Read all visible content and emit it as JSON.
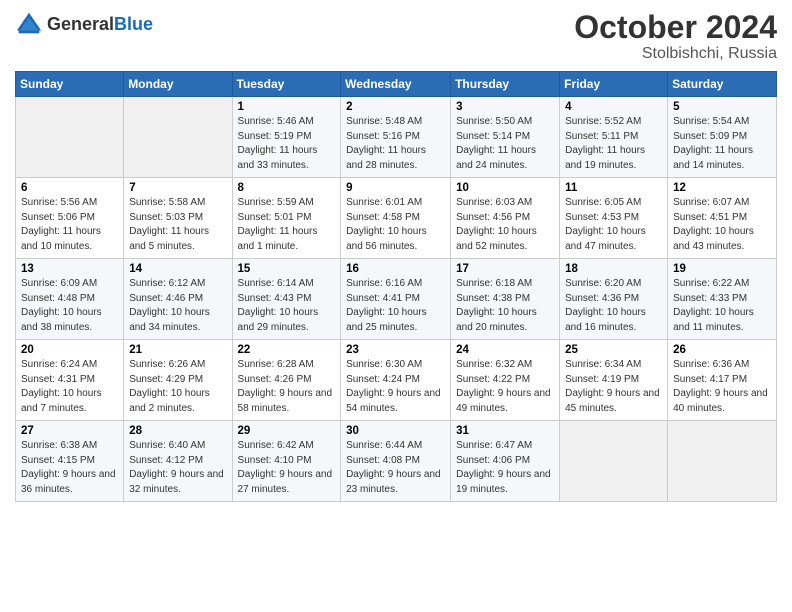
{
  "header": {
    "logo_general": "General",
    "logo_blue": "Blue",
    "month": "October 2024",
    "location": "Stolbishchi, Russia"
  },
  "days_of_week": [
    "Sunday",
    "Monday",
    "Tuesday",
    "Wednesday",
    "Thursday",
    "Friday",
    "Saturday"
  ],
  "weeks": [
    [
      {
        "day": "",
        "info": ""
      },
      {
        "day": "",
        "info": ""
      },
      {
        "day": "1",
        "info": "Sunrise: 5:46 AM\nSunset: 5:19 PM\nDaylight: 11 hours and 33 minutes."
      },
      {
        "day": "2",
        "info": "Sunrise: 5:48 AM\nSunset: 5:16 PM\nDaylight: 11 hours and 28 minutes."
      },
      {
        "day": "3",
        "info": "Sunrise: 5:50 AM\nSunset: 5:14 PM\nDaylight: 11 hours and 24 minutes."
      },
      {
        "day": "4",
        "info": "Sunrise: 5:52 AM\nSunset: 5:11 PM\nDaylight: 11 hours and 19 minutes."
      },
      {
        "day": "5",
        "info": "Sunrise: 5:54 AM\nSunset: 5:09 PM\nDaylight: 11 hours and 14 minutes."
      }
    ],
    [
      {
        "day": "6",
        "info": "Sunrise: 5:56 AM\nSunset: 5:06 PM\nDaylight: 11 hours and 10 minutes."
      },
      {
        "day": "7",
        "info": "Sunrise: 5:58 AM\nSunset: 5:03 PM\nDaylight: 11 hours and 5 minutes."
      },
      {
        "day": "8",
        "info": "Sunrise: 5:59 AM\nSunset: 5:01 PM\nDaylight: 11 hours and 1 minute."
      },
      {
        "day": "9",
        "info": "Sunrise: 6:01 AM\nSunset: 4:58 PM\nDaylight: 10 hours and 56 minutes."
      },
      {
        "day": "10",
        "info": "Sunrise: 6:03 AM\nSunset: 4:56 PM\nDaylight: 10 hours and 52 minutes."
      },
      {
        "day": "11",
        "info": "Sunrise: 6:05 AM\nSunset: 4:53 PM\nDaylight: 10 hours and 47 minutes."
      },
      {
        "day": "12",
        "info": "Sunrise: 6:07 AM\nSunset: 4:51 PM\nDaylight: 10 hours and 43 minutes."
      }
    ],
    [
      {
        "day": "13",
        "info": "Sunrise: 6:09 AM\nSunset: 4:48 PM\nDaylight: 10 hours and 38 minutes."
      },
      {
        "day": "14",
        "info": "Sunrise: 6:12 AM\nSunset: 4:46 PM\nDaylight: 10 hours and 34 minutes."
      },
      {
        "day": "15",
        "info": "Sunrise: 6:14 AM\nSunset: 4:43 PM\nDaylight: 10 hours and 29 minutes."
      },
      {
        "day": "16",
        "info": "Sunrise: 6:16 AM\nSunset: 4:41 PM\nDaylight: 10 hours and 25 minutes."
      },
      {
        "day": "17",
        "info": "Sunrise: 6:18 AM\nSunset: 4:38 PM\nDaylight: 10 hours and 20 minutes."
      },
      {
        "day": "18",
        "info": "Sunrise: 6:20 AM\nSunset: 4:36 PM\nDaylight: 10 hours and 16 minutes."
      },
      {
        "day": "19",
        "info": "Sunrise: 6:22 AM\nSunset: 4:33 PM\nDaylight: 10 hours and 11 minutes."
      }
    ],
    [
      {
        "day": "20",
        "info": "Sunrise: 6:24 AM\nSunset: 4:31 PM\nDaylight: 10 hours and 7 minutes."
      },
      {
        "day": "21",
        "info": "Sunrise: 6:26 AM\nSunset: 4:29 PM\nDaylight: 10 hours and 2 minutes."
      },
      {
        "day": "22",
        "info": "Sunrise: 6:28 AM\nSunset: 4:26 PM\nDaylight: 9 hours and 58 minutes."
      },
      {
        "day": "23",
        "info": "Sunrise: 6:30 AM\nSunset: 4:24 PM\nDaylight: 9 hours and 54 minutes."
      },
      {
        "day": "24",
        "info": "Sunrise: 6:32 AM\nSunset: 4:22 PM\nDaylight: 9 hours and 49 minutes."
      },
      {
        "day": "25",
        "info": "Sunrise: 6:34 AM\nSunset: 4:19 PM\nDaylight: 9 hours and 45 minutes."
      },
      {
        "day": "26",
        "info": "Sunrise: 6:36 AM\nSunset: 4:17 PM\nDaylight: 9 hours and 40 minutes."
      }
    ],
    [
      {
        "day": "27",
        "info": "Sunrise: 6:38 AM\nSunset: 4:15 PM\nDaylight: 9 hours and 36 minutes."
      },
      {
        "day": "28",
        "info": "Sunrise: 6:40 AM\nSunset: 4:12 PM\nDaylight: 9 hours and 32 minutes."
      },
      {
        "day": "29",
        "info": "Sunrise: 6:42 AM\nSunset: 4:10 PM\nDaylight: 9 hours and 27 minutes."
      },
      {
        "day": "30",
        "info": "Sunrise: 6:44 AM\nSunset: 4:08 PM\nDaylight: 9 hours and 23 minutes."
      },
      {
        "day": "31",
        "info": "Sunrise: 6:47 AM\nSunset: 4:06 PM\nDaylight: 9 hours and 19 minutes."
      },
      {
        "day": "",
        "info": ""
      },
      {
        "day": "",
        "info": ""
      }
    ]
  ]
}
